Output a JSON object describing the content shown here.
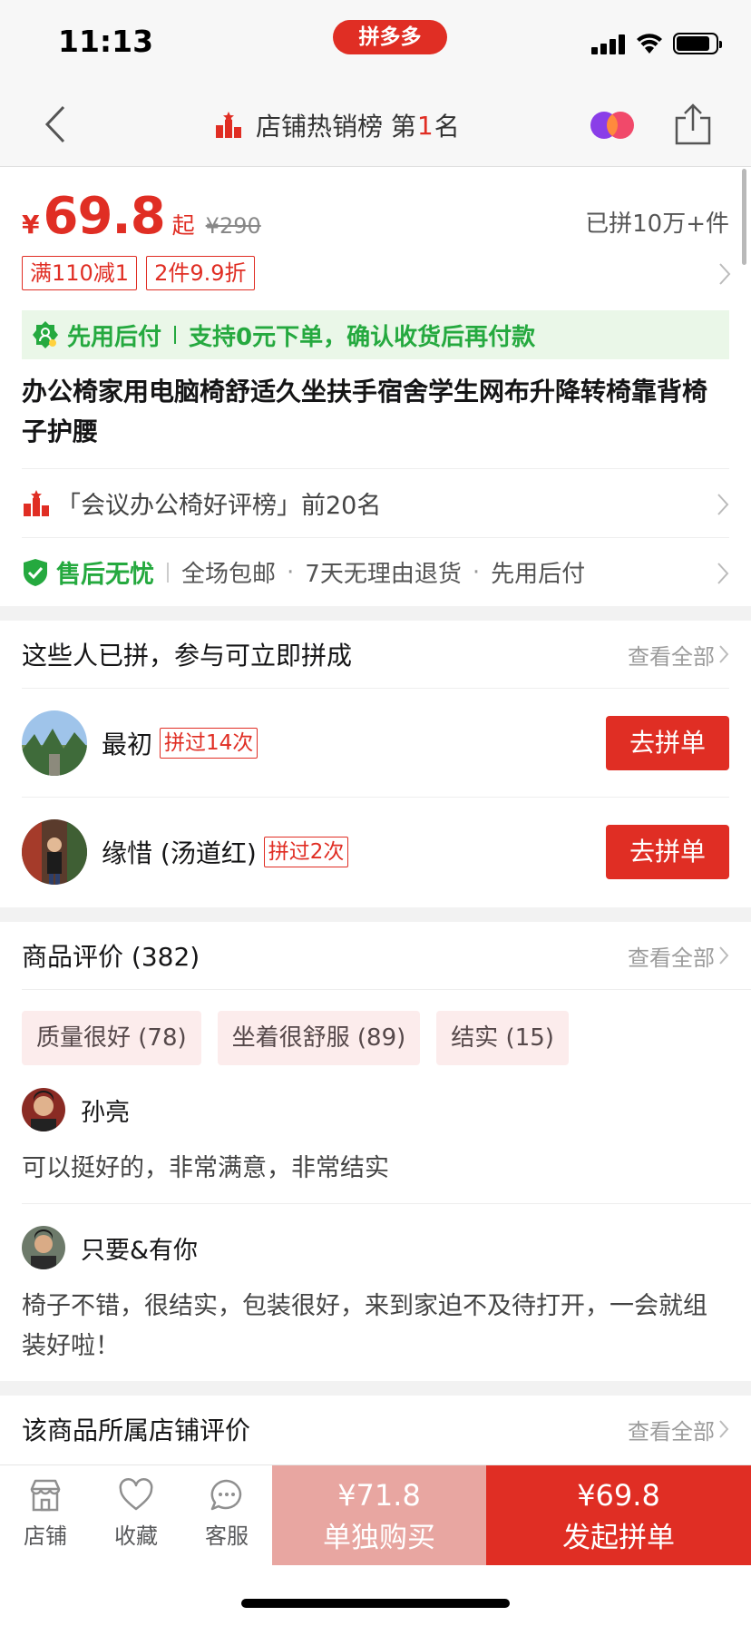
{
  "status_bar": {
    "time": "11:13",
    "brand": "拼多多",
    "icons": [
      "signal-icon",
      "wifi-icon",
      "battery-icon"
    ]
  },
  "nav": {
    "rank_prefix": "店铺热销榜 第",
    "rank_number": "1",
    "rank_suffix": "名",
    "icons": [
      "back-icon",
      "rank-icon",
      "avatar-pair-icon",
      "share-icon"
    ]
  },
  "price": {
    "currency": "¥",
    "value": "69.8",
    "suffix": "起",
    "original": "¥290",
    "sold": "已拼10万+件"
  },
  "coupons": [
    "满110减1",
    "2件9.9折"
  ],
  "bnpl": {
    "label": "先用后付",
    "desc": "支持0元下单，确认收货后再付款"
  },
  "product": {
    "title": "办公椅家用电脑椅舒适久坐扶手宿舍学生网布升降转椅靠背椅子护腰"
  },
  "ranking": {
    "text": "「会议办公椅好评榜」前20名"
  },
  "service": {
    "main": "售后无忧",
    "items": [
      "全场包邮",
      "7天无理由退货",
      "先用后付"
    ],
    "dot": "·"
  },
  "group_section": {
    "title": "这些人已拼，参与可立即拼成",
    "see_all": "查看全部",
    "members": [
      {
        "name": "最初",
        "times": "拼过14次",
        "button": "去拼单"
      },
      {
        "name": "缘惜 (汤道红)",
        "times": "拼过2次",
        "button": "去拼单"
      }
    ]
  },
  "reviews_section": {
    "title": "商品评价 (382)",
    "see_all": "查看全部",
    "tags": [
      "质量很好 (78)",
      "坐着很舒服 (89)",
      "结实 (15)"
    ],
    "reviews": [
      {
        "user": "孙亮",
        "text": "可以挺好的，非常满意，非常结实"
      },
      {
        "user": "只要&有你",
        "text": "椅子不错，很结实，包装很好，来到家迫不及待打开，一会就组装好啦！"
      }
    ]
  },
  "store_section": {
    "title": "该商品所属店铺评价",
    "see_all": "查看全部"
  },
  "bottom_bar": {
    "tabs": [
      {
        "label": "店铺",
        "icon": "store-icon"
      },
      {
        "label": "收藏",
        "icon": "heart-icon"
      },
      {
        "label": "客服",
        "icon": "chat-icon"
      }
    ],
    "buy_alone": {
      "price": "¥71.8",
      "label": "单独购买"
    },
    "buy_group": {
      "price": "¥69.8",
      "label": "发起拼单"
    }
  },
  "colors": {
    "accent": "#e02e24",
    "green": "#25a93f",
    "buy_alone_bg": "#e8a6a1"
  }
}
